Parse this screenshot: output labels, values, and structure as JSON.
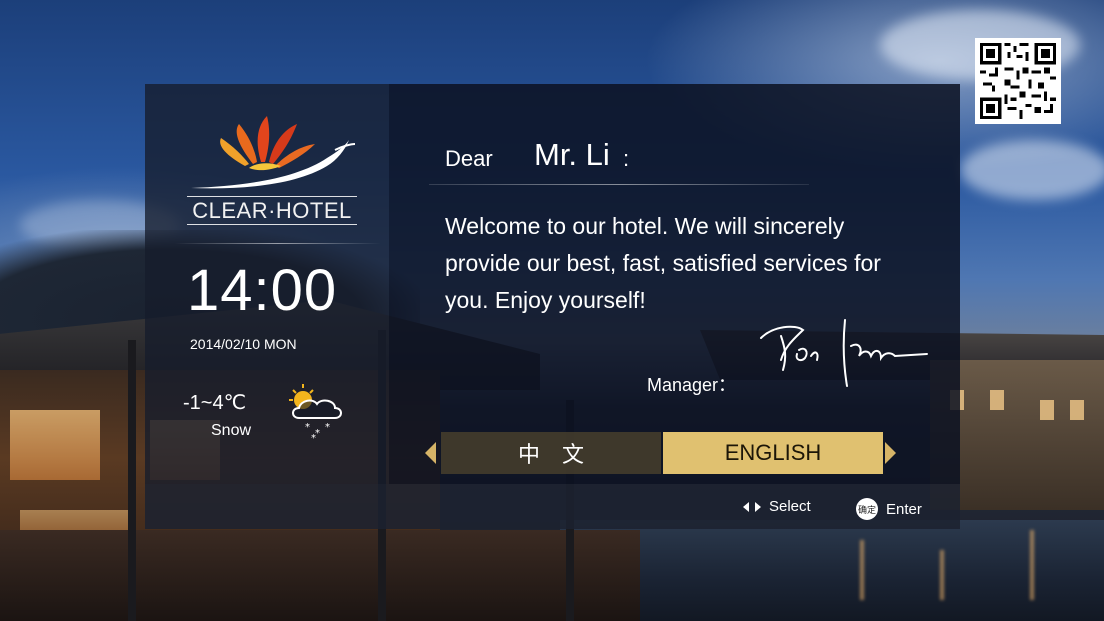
{
  "hotel": {
    "logo_text": "CLEAR·HOTEL"
  },
  "clock": {
    "time": "14:00",
    "date": "2014/02/10 MON"
  },
  "weather": {
    "temperature": "-1~4℃",
    "condition": "Snow",
    "icon": "partly-sunny-snow-icon"
  },
  "greeting": {
    "salutation": "Dear",
    "guest_name": "Mr. Li",
    "colon": ":",
    "message": "Welcome to our hotel. We will sincerely provide our best, fast, satisfied services for you. Enjoy yourself!",
    "manager_label": "Manager："
  },
  "language": {
    "options": [
      {
        "label": "中文",
        "selected": false
      },
      {
        "label": "ENGLISH",
        "selected": true
      }
    ]
  },
  "footer": {
    "select_label": "Select",
    "enter_label": "Enter",
    "ok_badge": "确定"
  },
  "colors": {
    "accent_gold": "#e0c170",
    "panel_dark": "#0c1222"
  }
}
